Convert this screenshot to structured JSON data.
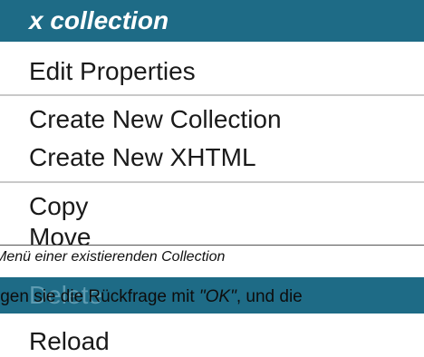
{
  "menu": {
    "title": "x collection",
    "items": {
      "edit_properties": "Edit Properties",
      "create_collection": "Create New Collection",
      "create_xhtml": "Create New XHTML",
      "copy": "Copy",
      "move": "Move",
      "delete": "Delete",
      "refresh": "Reload"
    }
  },
  "caption": "Menü einer existierenden Collection",
  "sentence": {
    "part1": "igen sie die Rückfrage mit ",
    "ok": "\"OK\"",
    "part2": ", und die"
  },
  "colors": {
    "header_bg": "#1e6b86",
    "highlight_bg": "#1e6b86"
  }
}
